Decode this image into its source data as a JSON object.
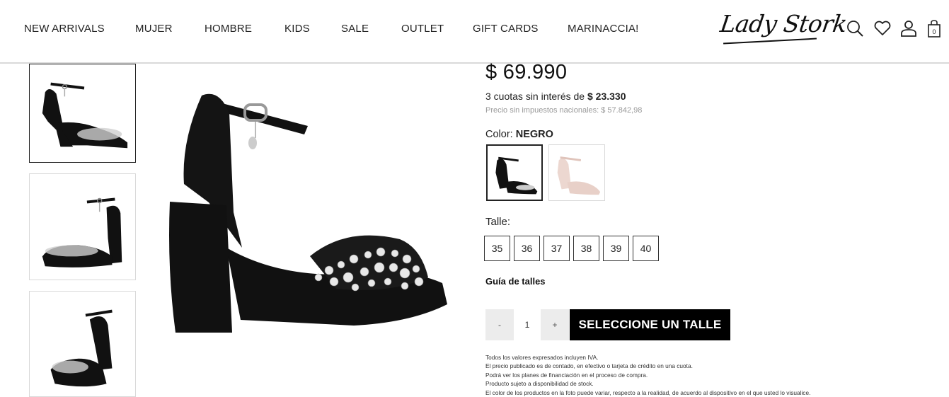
{
  "nav": {
    "items": [
      {
        "label": "NEW ARRIVALS"
      },
      {
        "label": "MUJER"
      },
      {
        "label": "HOMBRE"
      },
      {
        "label": "KIDS"
      },
      {
        "label": "SALE"
      },
      {
        "label": "OUTLET"
      },
      {
        "label": "GIFT CARDS"
      },
      {
        "label": "MARINACCIA!"
      }
    ]
  },
  "brand": {
    "logo_text": "Lady Stork"
  },
  "header_icons": {
    "search": "search-icon",
    "wishlist": "heart-icon",
    "account": "user-icon",
    "cart": "shopping-bag-icon",
    "cart_count": "0"
  },
  "gallery": {
    "thumbnails": [
      "sandal-side-view",
      "sandal-front-angle",
      "sandal-back-angle"
    ],
    "selected_index": 0
  },
  "product": {
    "price": "$ 69.990",
    "installments_prefix": "3 cuotas sin interés de ",
    "installments_amount": "$ 23.330",
    "tax_note": "Precio sin impuestos nacionales: $ 57.842,98",
    "color_prefix": "Color: ",
    "color_value": "NEGRO",
    "colors": [
      {
        "name": "NEGRO",
        "hex": "#111111",
        "selected": true
      },
      {
        "name": "nude",
        "hex": "#ecd7d0",
        "selected": false
      }
    ],
    "size_label": "Talle:",
    "sizes": [
      "35",
      "36",
      "37",
      "38",
      "39",
      "40"
    ],
    "size_guide_label": "Guía de talles",
    "quantity": {
      "minus": "-",
      "value": "1",
      "plus": "+"
    },
    "cta_label": "SELECCIONE UN TALLE",
    "disclaimer": [
      "Todos los valores expresados incluyen IVA.",
      "El precio publicado es de contado, en efectivo o tarjeta de crédito en una cuota.",
      "Podrá ver los planes de financiación en el proceso de compra.",
      "Producto sujeto a disponibilidad de stock.",
      "El color de los productos en la foto puede variar, respecto a la realidad, de acuerdo al dispositivo en el que usted lo visualice."
    ]
  },
  "colors": {
    "text": "#111111",
    "muted": "#999999",
    "cta_bg": "#000000",
    "border": "#d9d9d9"
  }
}
